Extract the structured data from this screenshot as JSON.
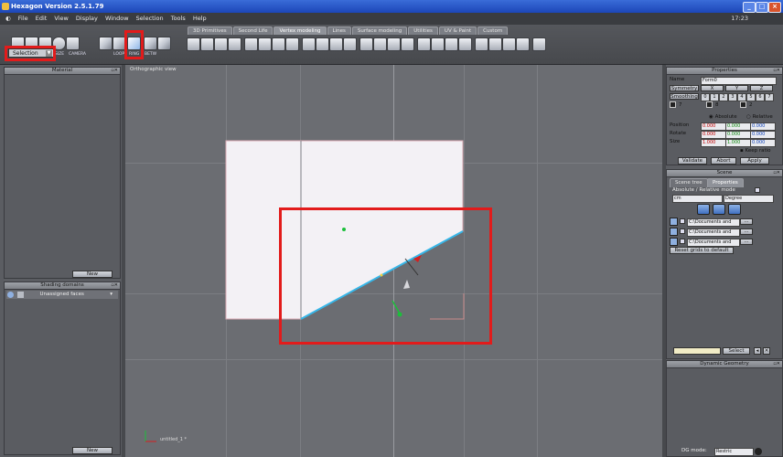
{
  "window": {
    "title": "Hexagon Version 2.5.1.79"
  },
  "menu": [
    "File",
    "Edit",
    "View",
    "Display",
    "Window",
    "Selection",
    "Tools",
    "Help"
  ],
  "clock": "17:23",
  "toolbar": {
    "tabs": [
      "3D Primitives",
      "Second Life",
      "Vertex modeling",
      "Lines",
      "Surface modeling",
      "Utilities",
      "UV & Paint",
      "Custom"
    ],
    "active_tab": "Vertex modeling",
    "selection_mode": "Selection",
    "small_labels": {
      "size": "SIZE",
      "camera": "CAMERA",
      "loop": "LOOP",
      "ring": "RING",
      "betw": "BETW"
    }
  },
  "left_panel": {
    "material": {
      "title": "Material",
      "new_label": "New"
    },
    "shading": {
      "title": "Shading domains",
      "item": "Unassigned faces",
      "new_label": "New"
    }
  },
  "viewport": {
    "title": "Orthographic view",
    "axis_label": "untitled_1 *"
  },
  "properties": {
    "title": "Properties",
    "name_label": "Name",
    "name_value": "Form0",
    "symmetry_label": "Symmetry",
    "axes": [
      "X",
      "Y",
      "Z"
    ],
    "smoothing_label": "Smoothing",
    "smoothing_levels": [
      "0",
      "1",
      "2",
      "3",
      "4",
      "5",
      "6",
      "7"
    ],
    "counts": [
      "7",
      "8",
      "2"
    ],
    "absolute_label": "Absolute",
    "relative_label": "Relative",
    "position_label": "Position",
    "rotate_label": "Rotate",
    "size_label": "Size",
    "position": [
      "0.000",
      "0.000",
      "0.000"
    ],
    "rotate": [
      "0.000",
      "0.000",
      "0.000"
    ],
    "size": [
      "1.000",
      "1.000",
      "0.000"
    ],
    "keep_ratio": "Keep ratio",
    "validate": "Validate",
    "abort": "Abort",
    "apply": "Apply"
  },
  "scene": {
    "title": "Scene",
    "tabs": [
      "Scene tree",
      "Properties"
    ],
    "mode_label": "Absolute / Relative mode",
    "unit": "cm",
    "angle_unit": "Degree",
    "paths": [
      "C:\\Documents and",
      "C:\\Documents and",
      "C:\\Documents and"
    ],
    "reset_label": "Reset grids to default"
  },
  "bottom_right": {
    "select_label": "Select",
    "dynamic_geometry": "Dynamic Geometry",
    "dg_mode_label": "DG mode:",
    "dg_mode_value": "Restric"
  }
}
